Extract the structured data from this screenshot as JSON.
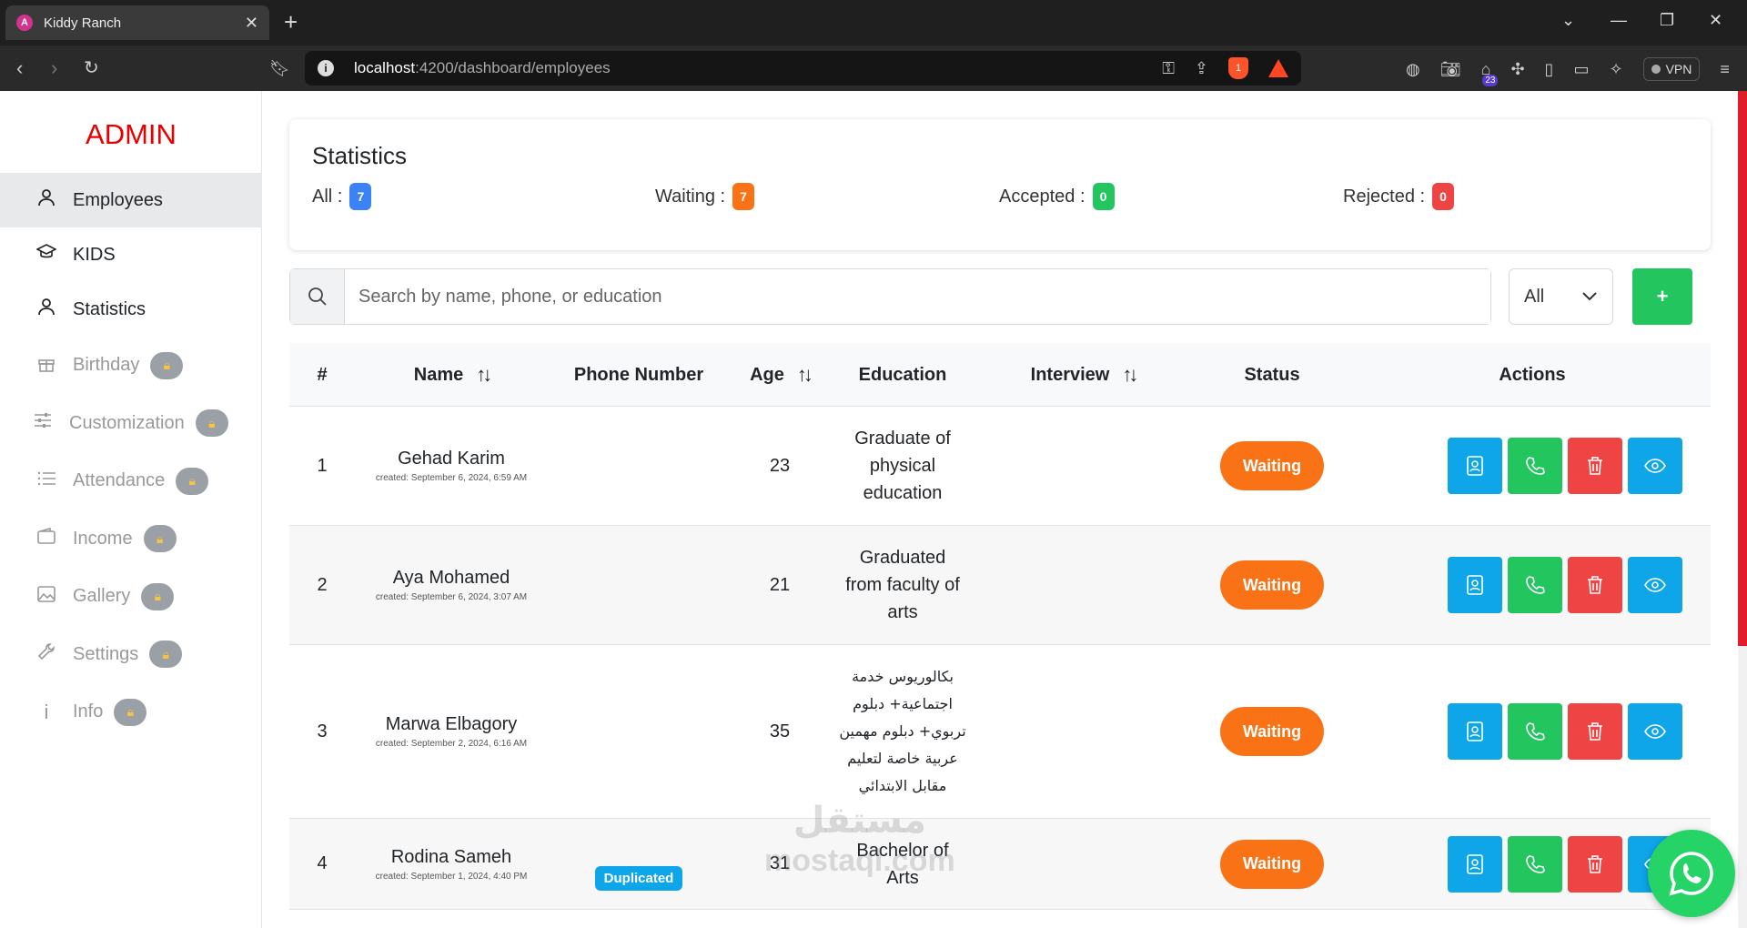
{
  "browser": {
    "tab_title": "Kiddy Ranch",
    "tab_close": "✕",
    "new_tab": "+",
    "url_host": "localhost",
    "url_path": ":4200/dashboard/employees",
    "ext_badge": "23",
    "brave_badge": "1",
    "vpn_label": "VPN"
  },
  "sidebar": {
    "brand": "ADMIN",
    "items": [
      {
        "label": "Employees",
        "icon": "user-icon",
        "active": true
      },
      {
        "label": "KIDS",
        "icon": "graduation-cap-icon"
      },
      {
        "label": "Statistics",
        "icon": "user-icon"
      },
      {
        "label": "Birthday",
        "icon": "gift-icon",
        "locked": true
      },
      {
        "label": "Customization",
        "icon": "sliders-icon",
        "locked": true
      },
      {
        "label": "Attendance",
        "icon": "list-icon",
        "locked": true
      },
      {
        "label": "Income",
        "icon": "wallet-icon",
        "locked": true
      },
      {
        "label": "Gallery",
        "icon": "image-icon",
        "locked": true
      },
      {
        "label": "Settings",
        "icon": "wrench-icon",
        "locked": true
      },
      {
        "label": "Info",
        "icon": "info-icon",
        "locked": true
      }
    ]
  },
  "stats": {
    "title": "Statistics",
    "all_label": "All :",
    "all_count": "7",
    "all_color": "#3b82f6",
    "waiting_label": "Waiting :",
    "waiting_count": "7",
    "waiting_color": "#f97316",
    "accepted_label": "Accepted :",
    "accepted_count": "0",
    "accepted_color": "#22c55e",
    "rejected_label": "Rejected :",
    "rejected_count": "0",
    "rejected_color": "#ef4444"
  },
  "search": {
    "placeholder": "Search by name, phone, or education",
    "filter_value": "All",
    "add_label": "+"
  },
  "table": {
    "headers": {
      "num": "#",
      "name": "Name",
      "phone": "Phone Number",
      "age": "Age",
      "education": "Education",
      "interview": "Interview",
      "status": "Status",
      "actions": "Actions"
    },
    "rows": [
      {
        "num": "1",
        "name": "Gehad Karim",
        "created": "created: September 6, 2024, 6:59 AM",
        "phone": "",
        "age": "23",
        "education": "Graduate of physical education",
        "interview": "",
        "status": "Waiting"
      },
      {
        "num": "2",
        "name": "Aya Mohamed",
        "created": "created: September 6, 2024, 3:07 AM",
        "phone": "",
        "age": "21",
        "education": "Graduated from faculty of arts",
        "interview": "",
        "status": "Waiting"
      },
      {
        "num": "3",
        "name": "Marwa Elbagory",
        "created": "created: September 2, 2024, 6:16 AM",
        "phone": "",
        "age": "35",
        "education": "بكالوريوس خدمة اجتماعية+ دبلوم تربوي+ دبلوم مهمين عربية خاصة لتعليم مقابل الابتدائي",
        "interview": "",
        "status": "Waiting"
      },
      {
        "num": "4",
        "name": "Rodina Sameh",
        "created": "created: September 1, 2024, 4:40 PM",
        "phone": "",
        "phone_badge": "Duplicated",
        "age": "31",
        "education": "Bachelor of Arts",
        "interview": "",
        "status": "Waiting"
      }
    ]
  },
  "watermark": {
    "line1": "مستقل",
    "line2": "mostaql.com"
  }
}
